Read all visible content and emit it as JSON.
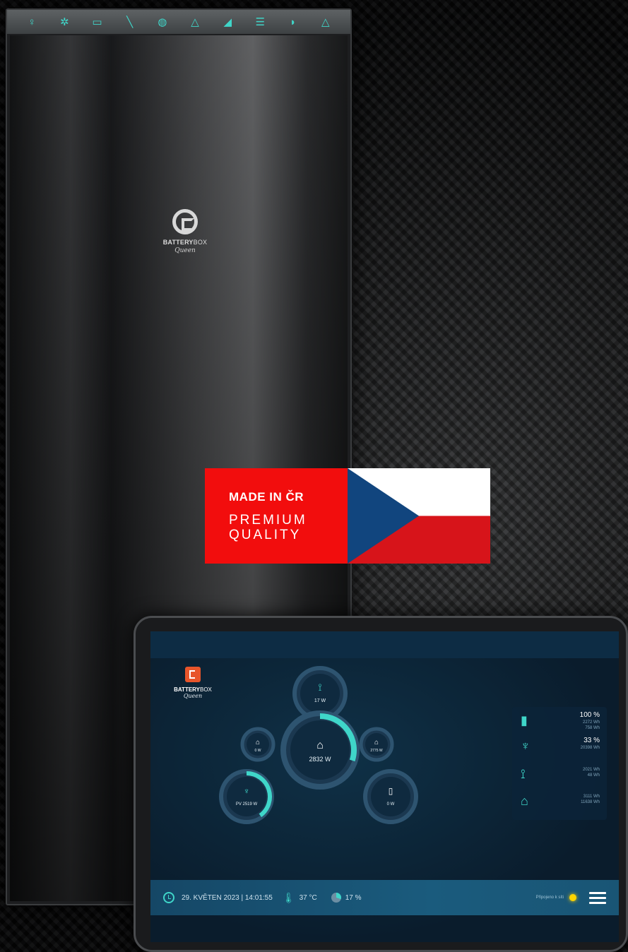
{
  "cabinet": {
    "strip_icons": [
      "bulb-icon",
      "sun-icon",
      "battery-icon",
      "plug-icon",
      "globe-icon",
      "warning-icon",
      "solar-panel-icon",
      "tower-icon",
      "car-icon",
      "alert-icon"
    ],
    "logo_brand_bold": "BATTERY",
    "logo_brand_light": "BOX",
    "logo_script": "Queen"
  },
  "badge": {
    "line1": "MADE IN ČR",
    "line2": "PREMIUM",
    "line3": "QUALITY",
    "colors": {
      "red": "#f20d0d",
      "flag_blue": "#11457e",
      "flag_red": "#d7141a",
      "flag_white": "#ffffff"
    }
  },
  "tablet_app": {
    "logo_brand_bold": "BATTERY",
    "logo_brand_light": "BOX",
    "logo_script": "Queen",
    "nodes": {
      "top": {
        "value": "17 W",
        "icon": "tower-icon"
      },
      "center": {
        "value": "2832 W",
        "icon": "home-icon",
        "fill_fraction": 0.3
      },
      "left_small": {
        "value": "0 W",
        "icon": "home-icon"
      },
      "right_small": {
        "value": "2775 W",
        "icon": "home-icon"
      },
      "pv": {
        "value": "PV 2519 W",
        "icon": "solar-icon",
        "fill_fraction": 0.4
      },
      "battery": {
        "value": "0 W",
        "icon": "battery-icon"
      }
    },
    "stats": [
      {
        "icon": "battery-icon",
        "main": "100 %",
        "sub1": "2272 Wh",
        "sub2": "758 Wh"
      },
      {
        "icon": "solar-icon",
        "main": "33 %",
        "sub1": "20398 Wh",
        "sub2": ""
      },
      {
        "icon": "tower-icon",
        "main": "",
        "sub1": "2021 Wh",
        "sub2": "48 Wh"
      },
      {
        "icon": "home-icon",
        "main": "",
        "sub1": "3111 Wh",
        "sub2": "11638 Wh"
      }
    ],
    "bottom_bar": {
      "datetime": "29. KVĚTEN 2023 | 14:01:55",
      "temperature": "37 °C",
      "humidity": "17 %",
      "connection_label": "Připojeno k síti"
    },
    "colors": {
      "accent": "#3fd6c9",
      "status": "#ffd400"
    }
  }
}
